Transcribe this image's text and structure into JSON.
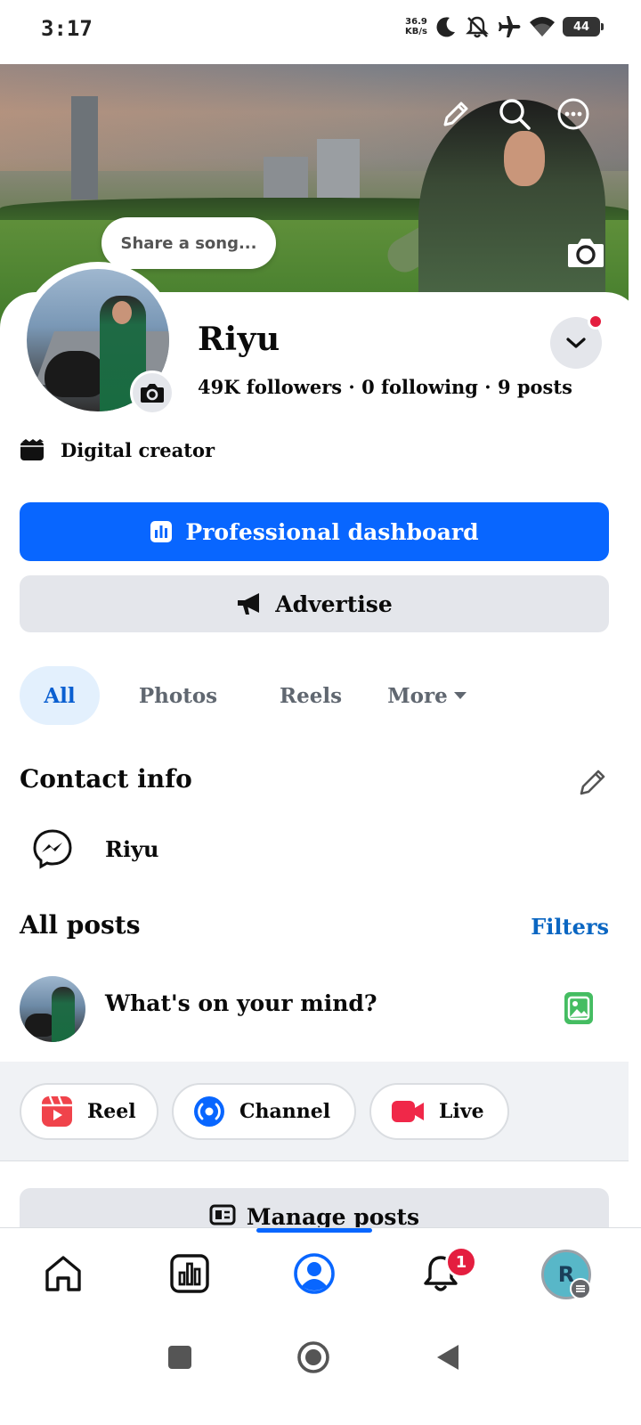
{
  "status_bar": {
    "time": "3:17",
    "net_speed_value": "36.9",
    "net_speed_unit": "KB/s",
    "battery": "44",
    "icons": [
      "moon-icon",
      "bell-off-icon",
      "airplane-icon",
      "wifi-icon",
      "battery-icon"
    ]
  },
  "cover": {
    "icons": [
      "edit-pencil-icon",
      "search-icon",
      "more-dots-icon",
      "camera-icon"
    ]
  },
  "song_bubble": {
    "label": "Share a song..."
  },
  "profile": {
    "name": "Riyu",
    "followers": "49K followers",
    "following": "0 following",
    "posts": "9 posts",
    "separator": " · ",
    "category": "Digital creator"
  },
  "buttons": {
    "dashboard": "Professional dashboard",
    "advertise": "Advertise"
  },
  "tabs": {
    "all": "All",
    "photos": "Photos",
    "reels": "Reels",
    "more": "More"
  },
  "contact": {
    "title": "Contact info",
    "messenger_name": "Riyu"
  },
  "posts": {
    "title": "All posts",
    "filters": "Filters",
    "composer_placeholder": "What's on your mind?"
  },
  "create": {
    "reel": "Reel",
    "channel": "Channel",
    "live": "Live"
  },
  "manage": {
    "label": "Manage posts"
  },
  "bottom_nav": {
    "items": [
      "home-icon",
      "insights-icon",
      "profile-icon",
      "notifications-icon",
      "menu-avatar"
    ],
    "notification_count": "1",
    "avatar_initial": "R",
    "active": "profile"
  },
  "colors": {
    "primary_blue": "#0866ff",
    "tab_active_bg": "#e3f0fd",
    "tab_active_text": "#0a5fd1",
    "secondary_btn": "#e4e6eb",
    "badge_red": "#e41e3f",
    "link_blue": "#0a66c2",
    "reel_red": "#f0434b",
    "live_red": "#f02849",
    "photo_green": "#45bd62"
  }
}
